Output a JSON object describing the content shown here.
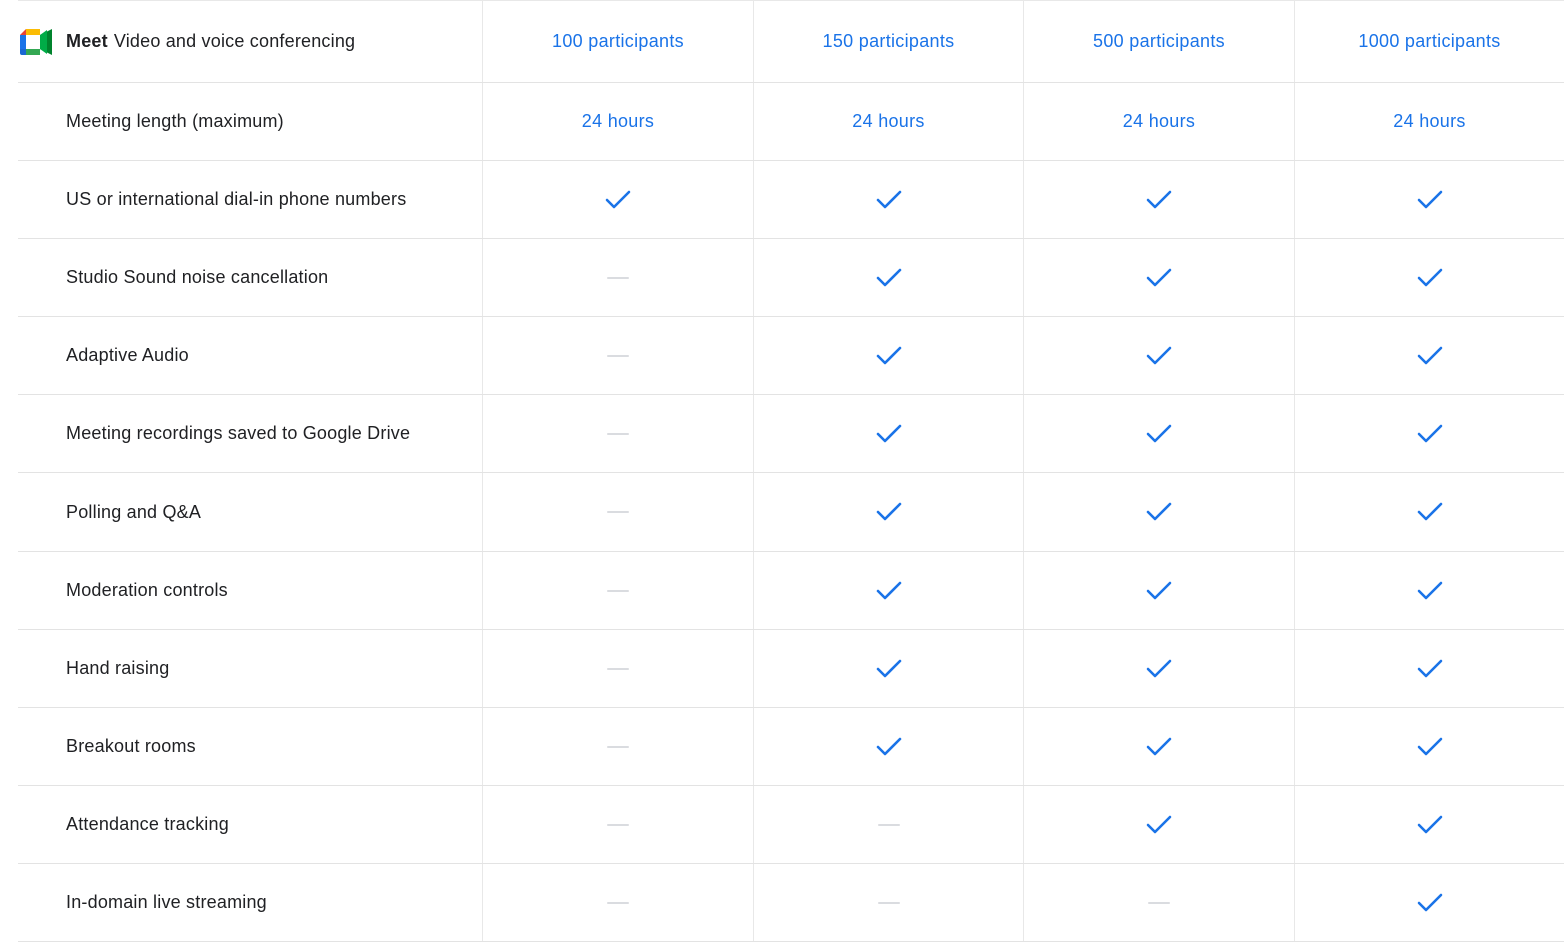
{
  "product": {
    "name": "Meet",
    "tagline": "Video and voice conferencing",
    "icon": "google-meet-logo-icon"
  },
  "plans": [
    "100 participants",
    "150 participants",
    "500 participants",
    "1000 participants"
  ],
  "meeting_length": {
    "label": "Meeting length (maximum)",
    "values": [
      "24 hours",
      "24 hours",
      "24 hours",
      "24 hours"
    ]
  },
  "features": [
    {
      "label": "US or international dial-in phone numbers",
      "availability": [
        true,
        true,
        true,
        true
      ]
    },
    {
      "label": "Studio Sound noise cancellation",
      "availability": [
        false,
        true,
        true,
        true
      ]
    },
    {
      "label": "Adaptive Audio",
      "availability": [
        false,
        true,
        true,
        true
      ]
    },
    {
      "label": "Meeting recordings saved to Google Drive",
      "availability": [
        false,
        true,
        true,
        true
      ]
    },
    {
      "label": "Polling and Q&A",
      "availability": [
        false,
        true,
        true,
        true
      ]
    },
    {
      "label": "Moderation controls",
      "availability": [
        false,
        true,
        true,
        true
      ]
    },
    {
      "label": "Hand raising",
      "availability": [
        false,
        true,
        true,
        true
      ]
    },
    {
      "label": "Breakout rooms",
      "availability": [
        false,
        true,
        true,
        true
      ]
    },
    {
      "label": "Attendance tracking",
      "availability": [
        false,
        false,
        true,
        true
      ]
    },
    {
      "label": "In-domain live streaming",
      "availability": [
        false,
        false,
        false,
        true
      ]
    }
  ],
  "icons": {
    "included": "checkmark-icon",
    "not_included": "dash-icon"
  },
  "colors": {
    "accent": "#1a73e8",
    "check": "#1a73e8",
    "dash": "#dadce0",
    "divider": "#e3e3e3"
  }
}
